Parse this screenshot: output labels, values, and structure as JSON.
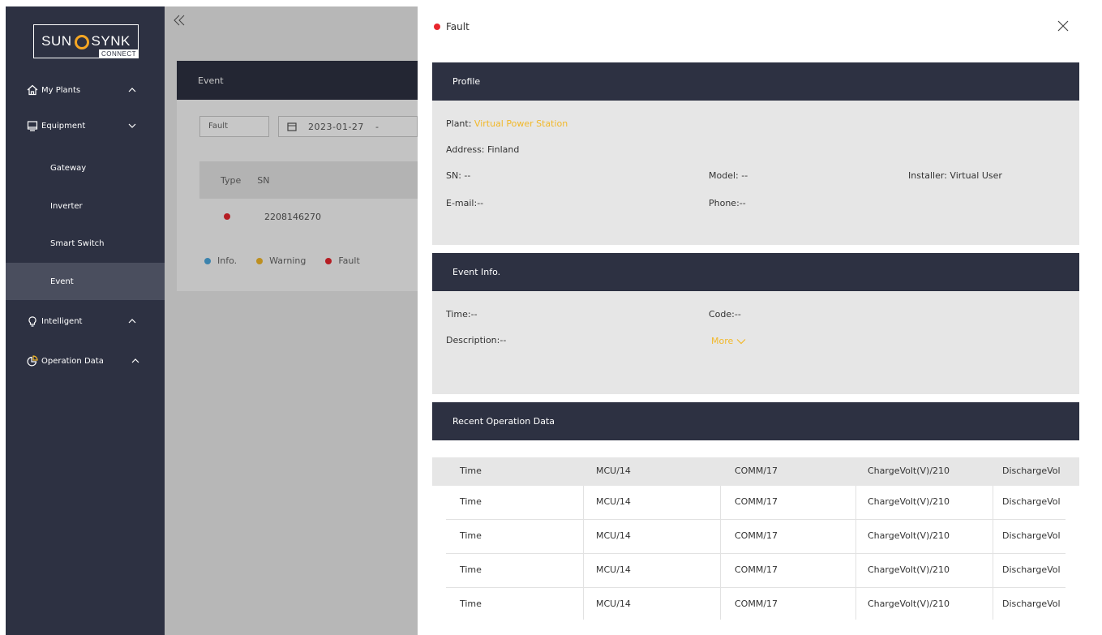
{
  "brand": {
    "left": "SUN",
    "right": "SYNK",
    "sub": "CONNECT"
  },
  "sidebar": {
    "items": [
      {
        "label": "My Plants",
        "icon": "home-icon",
        "expanded": false
      },
      {
        "label": "Equipment",
        "icon": "monitor-icon",
        "expanded": true
      },
      {
        "label": "Intelligent",
        "icon": "bulb-icon",
        "expanded": false
      },
      {
        "label": "Operation Data",
        "icon": "pie-icon",
        "expanded": false
      }
    ],
    "subitems": [
      {
        "label": "Gateway",
        "active": false
      },
      {
        "label": "Inverter",
        "active": false
      },
      {
        "label": "Smart Switch",
        "active": false
      },
      {
        "label": "Event",
        "active": true
      }
    ]
  },
  "event_panel": {
    "title": "Event",
    "filter_type": "Fault",
    "filter_date": "2023-01-27",
    "filter_sep": "-",
    "columns": [
      "Type",
      "SN"
    ],
    "rows": [
      {
        "type_color": "#e8262d",
        "sn": "2208146270"
      }
    ],
    "legend": [
      {
        "label": "Info.",
        "color": "#4ea8de"
      },
      {
        "label": "Warning",
        "color": "#f2b829"
      },
      {
        "label": "Fault",
        "color": "#e8262d"
      }
    ]
  },
  "drawer": {
    "title": "Fault",
    "status_color": "#e8262d",
    "profile": {
      "heading": "Profile",
      "plant_label": "Plant:",
      "plant_value": "Virtual Power Station",
      "address": "Address: Finland",
      "sn": "SN: --",
      "model": "Model: --",
      "installer": "Installer: Virtual User",
      "email": "E-mail:--",
      "phone": "Phone:--"
    },
    "event_info": {
      "heading": "Event Info.",
      "time": "Time:--",
      "code": "Code:--",
      "description": "Description:--",
      "more": "More"
    },
    "recent": {
      "heading": "Recent Operation Data",
      "columns": [
        "Time",
        "MCU/14",
        "COMM/17",
        "ChargeVolt(V)/210",
        "DischargeVol"
      ],
      "rows": [
        [
          "Time",
          "MCU/14",
          "COMM/17",
          "ChargeVolt(V)/210",
          "DischargeVol"
        ],
        [
          "Time",
          "MCU/14",
          "COMM/17",
          "ChargeVolt(V)/210",
          "DischargeVol"
        ],
        [
          "Time",
          "MCU/14",
          "COMM/17",
          "ChargeVolt(V)/210",
          "DischargeVol"
        ],
        [
          "Time",
          "MCU/14",
          "COMM/17",
          "ChargeVolt(V)/210",
          "DischargeVol"
        ]
      ]
    }
  }
}
